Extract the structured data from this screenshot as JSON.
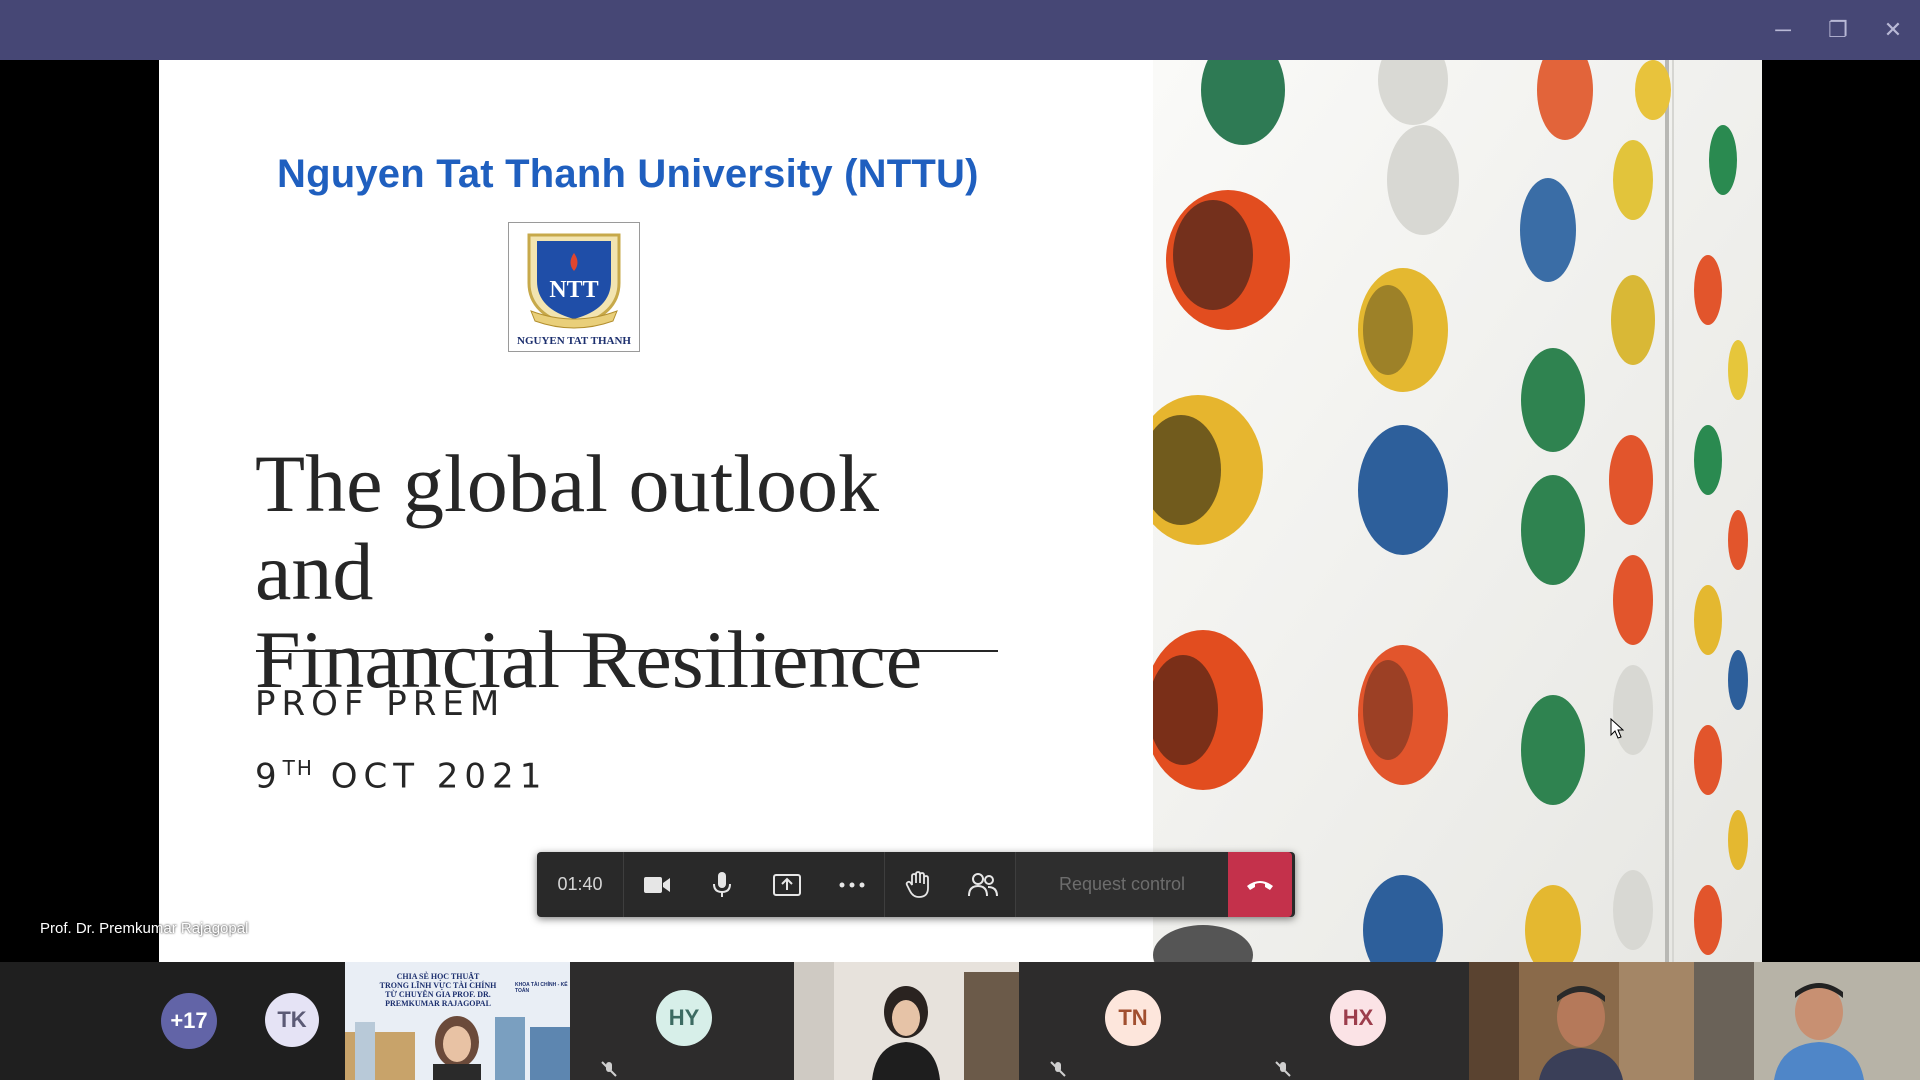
{
  "window": {
    "minimize_glyph": "─",
    "restore_glyph": "❐",
    "close_glyph": "✕"
  },
  "slide": {
    "university": "Nguyen Tat Thanh University (NTTU)",
    "logo_text": "NGUYEN TAT THANH",
    "title_line1": "The global outlook and",
    "title_line2": "Financial Resilience",
    "presenter": "PROF PREM",
    "date_day": "9",
    "date_suffix": "TH",
    "date_rest": " OCT 2021"
  },
  "presenter_label": "Prof. Dr. Premkumar Rajagopal",
  "toolbar": {
    "timer": "01:40",
    "request_control": "Request control",
    "icons": [
      "camera-icon",
      "microphone-icon",
      "share-screen-icon",
      "more-options-icon",
      "raise-hand-icon",
      "participants-icon",
      "hang-up-icon"
    ],
    "hangup_color": "#c4314b"
  },
  "participants": {
    "overflow_count": "+17",
    "tk": "TK",
    "hy": "HY",
    "tn": "TN",
    "hx": "HX",
    "banner_line1": "CHIA SẺ HỌC THUẬT",
    "banner_line2": "TRONG LĨNH VỰC TÀI CHÍNH",
    "banner_line3": "TỪ CHUYÊN GIA PROF. DR.",
    "banner_line4": "PREMKUMAR RAJAGOPAL",
    "banner_side": "KHOA TÀI CHÍNH - KẾ TOÁN"
  },
  "colors": {
    "titlebar": "#464775",
    "university_blue": "#1f5fbf",
    "avatar_purple": "#6264a7"
  }
}
